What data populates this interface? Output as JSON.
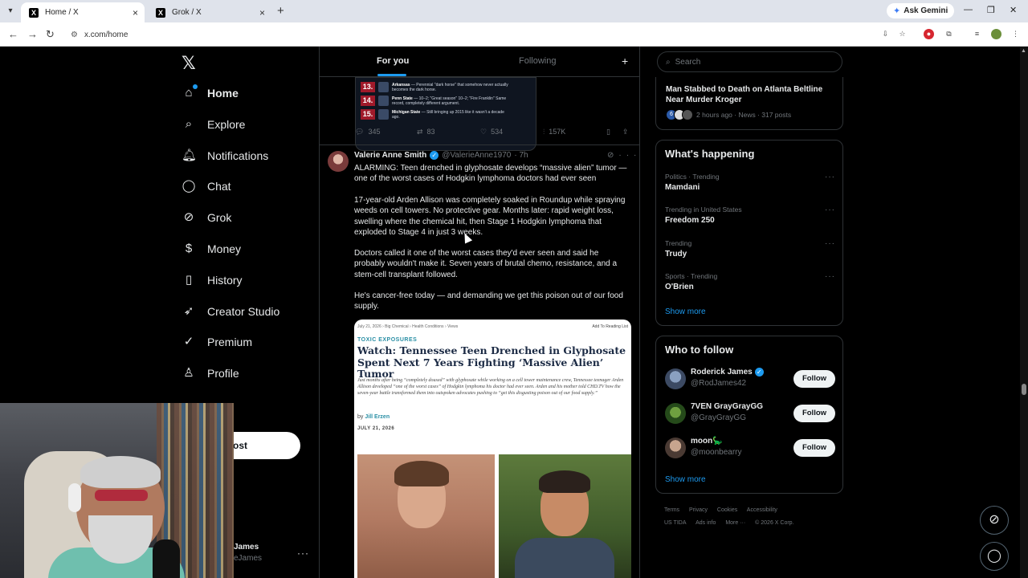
{
  "browser": {
    "tabs": [
      {
        "title": "Home / X"
      },
      {
        "title": "Grok / X"
      }
    ],
    "ask_gemini": "Ask Gemini",
    "url": "x.com/home"
  },
  "nav": {
    "items": [
      {
        "label": "Home",
        "icon": "home-icon"
      },
      {
        "label": "Explore",
        "icon": "search-icon"
      },
      {
        "label": "Notifications",
        "icon": "bell-icon"
      },
      {
        "label": "Chat",
        "icon": "chat-icon"
      },
      {
        "label": "Grok",
        "icon": "grok-icon"
      },
      {
        "label": "Money",
        "icon": "money-icon"
      },
      {
        "label": "History",
        "icon": "bookmark-icon"
      },
      {
        "label": "Creator Studio",
        "icon": "rocket-icon"
      },
      {
        "label": "Premium",
        "icon": "verified-icon"
      },
      {
        "label": "Profile",
        "icon": "user-icon"
      }
    ],
    "post_label": "ost",
    "account_name": "James",
    "account_handle": "eJames"
  },
  "feed": {
    "tabs": {
      "for_you": "For you",
      "following": "Following"
    },
    "rankings": [
      {
        "rank": "13.",
        "team": "Arkansas",
        "note": "— Perennial \"dark horse\" that somehow never actually becomes the dark horse."
      },
      {
        "rank": "14.",
        "team": "Penn State",
        "note": "— 10–2; \"Great season\" 10–2; \"Fire Franklin\" Same record, completely different argument."
      },
      {
        "rank": "15.",
        "team": "Michigan State",
        "note": "— Still bringing up 2015 like it wasn't a decade ago."
      }
    ],
    "prev_actions": {
      "replies": "345",
      "reposts": "83",
      "likes": "534",
      "views": "157K"
    },
    "tweet": {
      "name": "Valerie Anne Smith",
      "handle": "@ValerieAnne1970",
      "time": "· 7h",
      "p1": "ALARMING: Teen drenched in glyphosate develops “massive alien” tumor — one of the worst cases of Hodgkin lymphoma doctors had ever seen",
      "p2": "17-year-old Arden Allison was completely soaked in Roundup while spraying weeds on cell towers. No protective gear. Months later: rapid weight loss, swelling where the chemical hit, then Stage 1 Hodgkin lymphoma that exploded to Stage 4 in just 3 weeks.",
      "p3": "Doctors called it one of the worst cases they'd ever seen and said he probably wouldn't make it. Seven years of brutal chemo, resistance, and a stem-cell transplant followed.",
      "p4": "He's cancer-free today — and demanding we get this poison out of our food supply."
    },
    "article": {
      "meta": "July 21, 2026 › Big Chemical › Health Conditions › Views",
      "read_list": "Add To Reading List",
      "kicker": "TOXIC EXPOSURES",
      "title": "Watch: Tennessee Teen Drenched in Glyphosate Spent Next 7 Years Fighting ‘Massive Alien’ Tumor",
      "dek": "Just months after being “completely doused” with glyphosate while working on a cell tower maintenance crew, Tennessee teenager Arden Allison developed “one of the worst cases” of Hodgkin lymphoma his doctor had ever seen. Arden and his mother told CHD.TV how the seven-year battle transformed them into outspoken advocates pushing to “get this disgusting poison out of our food supply.”",
      "by_prefix": "by",
      "author": "Jill Erzen",
      "date": "JULY 21, 2026"
    }
  },
  "sidebar": {
    "search_placeholder": "Search",
    "news": {
      "title": "Man Stabbed to Death on Atlanta Beltline Near Murder Kroger",
      "meta": "2 hours ago · News · 317 posts"
    },
    "whats_happening": "What's happening",
    "trends": [
      {
        "category": "Politics · Trending",
        "name": "Mamdani"
      },
      {
        "category": "Trending in United States",
        "name": "Freedom 250"
      },
      {
        "category": "Trending",
        "name": "Trudy"
      },
      {
        "category": "Sports · Trending",
        "name": "O'Brien"
      }
    ],
    "show_more": "Show more",
    "who_to_follow": "Who to follow",
    "follows": [
      {
        "name": "Roderick James",
        "handle": "@RodJames42",
        "verified": true
      },
      {
        "name": "7VEN GrayGrayGG",
        "handle": "@GrayGrayGG",
        "verified": false
      },
      {
        "name": "moon🦕",
        "handle": "@moonbearry",
        "verified": false
      }
    ],
    "follow_label": "Follow",
    "footer_line1": [
      "Terms",
      "Privacy",
      "Cookies",
      "Accessibility"
    ],
    "footer_line2": [
      "US TIDA",
      "Ads info",
      "More ···",
      "© 2026 X Corp."
    ]
  }
}
